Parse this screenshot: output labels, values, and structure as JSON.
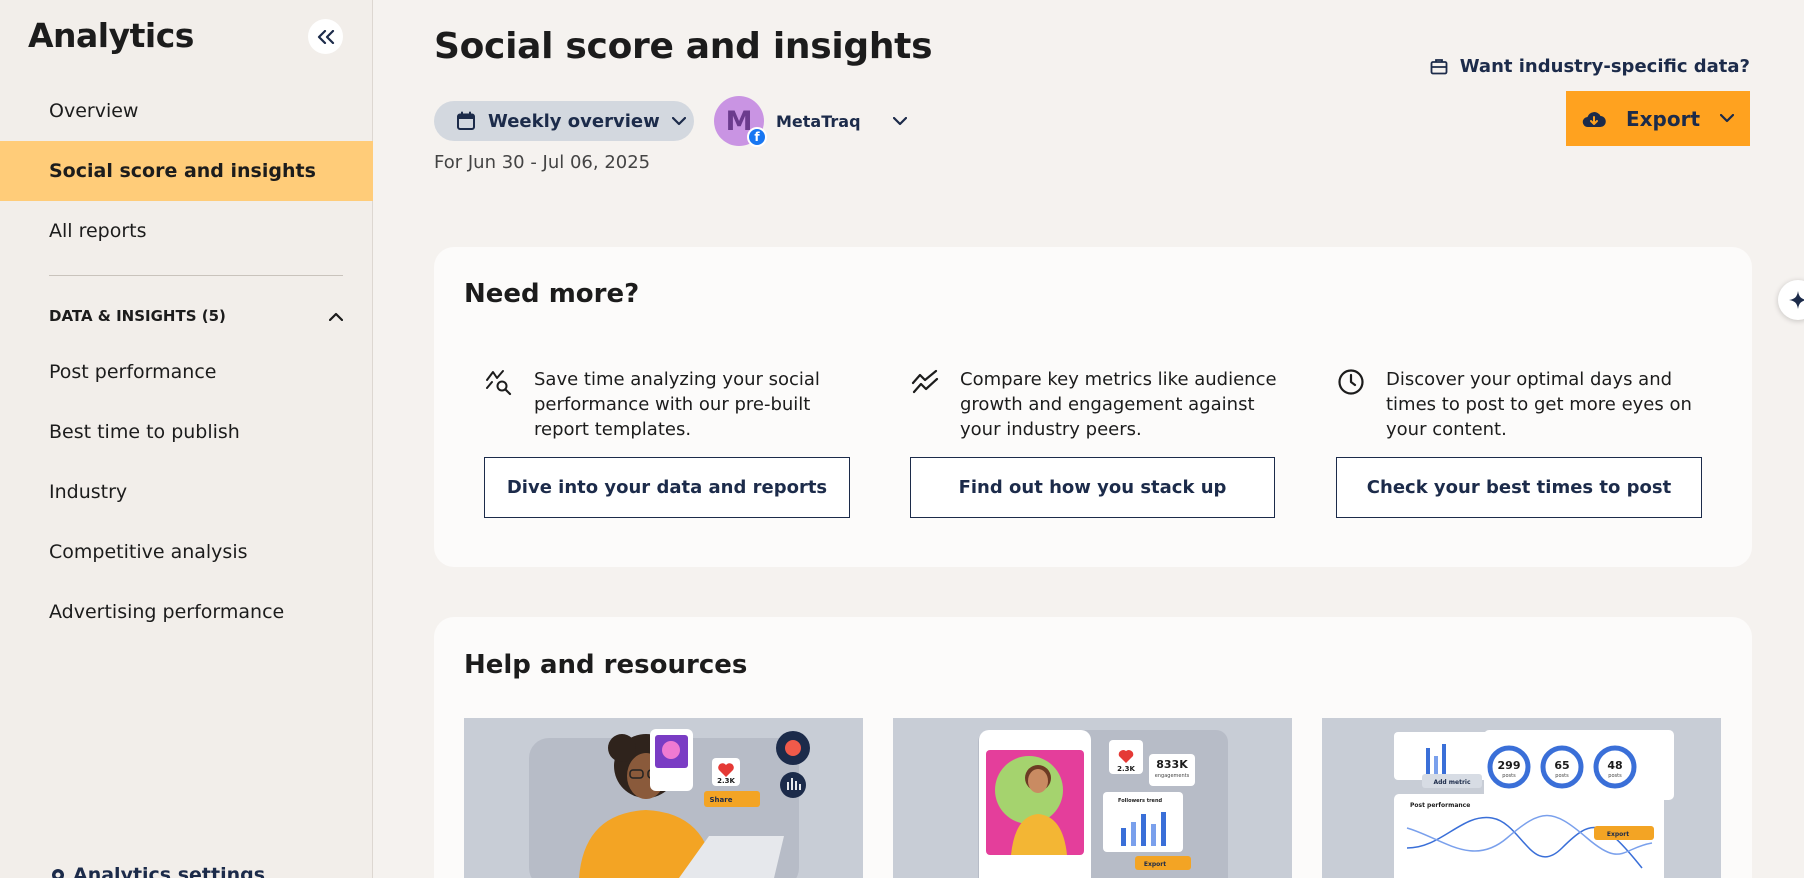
{
  "sidebar": {
    "title": "Analytics",
    "nav": [
      {
        "label": "Overview"
      },
      {
        "label": "Social score and insights"
      },
      {
        "label": "All reports"
      }
    ],
    "section": {
      "label": "DATA & INSIGHTS (5)"
    },
    "section_items": [
      {
        "label": "Post performance"
      },
      {
        "label": "Best time to publish"
      },
      {
        "label": "Industry"
      },
      {
        "label": "Competitive analysis"
      },
      {
        "label": "Advertising performance"
      }
    ],
    "settings_label": "Analytics settings"
  },
  "header": {
    "title": "Social score and insights",
    "period": "Weekly overview",
    "profile": {
      "initial": "M",
      "name": "MetaTraq"
    },
    "date_range": "For Jun 30 - Jul 06, 2025",
    "industry_link": "Want industry-specific data?",
    "export_label": "Export"
  },
  "need_more": {
    "title": "Need more?",
    "features": [
      {
        "icon": "chart-search-icon",
        "text": "Save time analyzing your social performance with our pre-built report templates.",
        "button": "Dive into your data and reports"
      },
      {
        "icon": "trend-lines-icon",
        "text": "Compare key metrics like audience growth and engagement against your industry peers.",
        "button": "Find out how you stack up"
      },
      {
        "icon": "clock-icon",
        "text": "Discover your optimal days and times to post to get more eyes on your content.",
        "button": "Check your best times to post"
      }
    ]
  },
  "help": {
    "title": "Help and resources",
    "thumbs": [
      {
        "like_count": "2.3K",
        "share_label": "Share"
      },
      {
        "like_count": "2.3K",
        "engagements": "833K",
        "engagements_label": "engagements",
        "followers_label": "Followers trend",
        "export_label": "Export"
      },
      {
        "add_metric": "Add metric",
        "gauges": [
          {
            "value": "299",
            "unit": "posts"
          },
          {
            "value": "65",
            "unit": "posts"
          },
          {
            "value": "48",
            "unit": "posts"
          }
        ],
        "panel_title": "Post performance",
        "export_label": "Export"
      }
    ]
  },
  "colors": {
    "accent": "#ffa21f",
    "active_nav": "#ffcc79",
    "navy": "#1c2b4a",
    "facebook": "#1877f2"
  }
}
